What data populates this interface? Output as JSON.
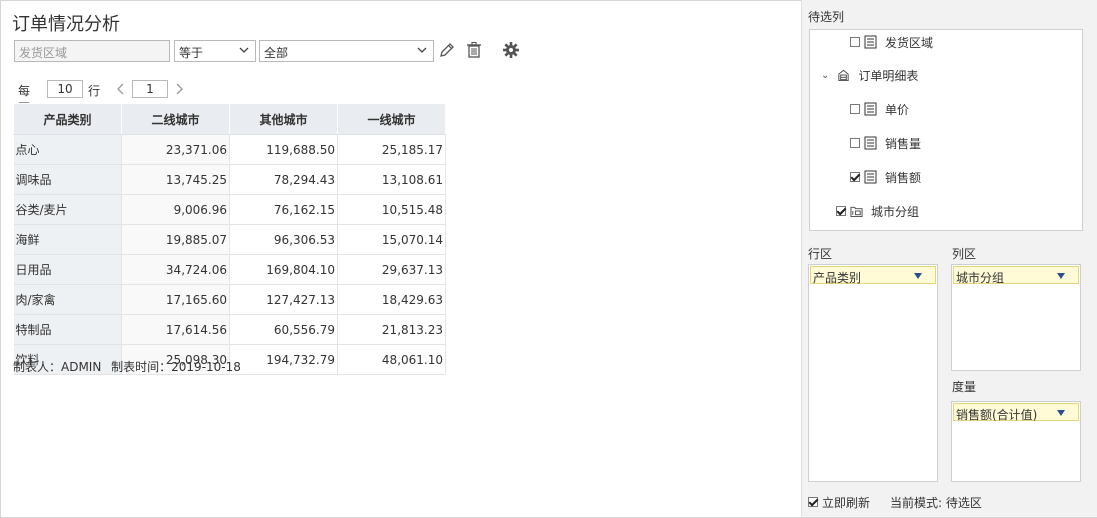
{
  "report": {
    "title": "订单情况分析",
    "filter": {
      "field_placeholder": "发货区域",
      "operator": "等于",
      "value": "全部"
    },
    "pager": {
      "per_page_label": "每页",
      "per_page_value": "10",
      "row_label": "行",
      "page_value": "1"
    },
    "table": {
      "headers": [
        "产品类别",
        "二线城市",
        "其他城市",
        "一线城市"
      ],
      "rows": [
        {
          "cat": "点心",
          "v": [
            "23,371.06",
            "119,688.50",
            "25,185.17"
          ]
        },
        {
          "cat": "调味品",
          "v": [
            "13,745.25",
            "78,294.43",
            "13,108.61"
          ]
        },
        {
          "cat": "谷类/麦片",
          "v": [
            "9,006.96",
            "76,162.15",
            "10,515.48"
          ]
        },
        {
          "cat": "海鲜",
          "v": [
            "19,885.07",
            "96,306.53",
            "15,070.14"
          ]
        },
        {
          "cat": "日用品",
          "v": [
            "34,724.06",
            "169,804.10",
            "29,637.13"
          ]
        },
        {
          "cat": "肉/家禽",
          "v": [
            "17,165.60",
            "127,427.13",
            "18,429.63"
          ]
        },
        {
          "cat": "特制品",
          "v": [
            "17,614.56",
            "60,556.79",
            "21,813.23"
          ]
        },
        {
          "cat": "饮料",
          "v": [
            "25,098.30",
            "194,732.79",
            "48,061.10"
          ]
        }
      ]
    },
    "footer": {
      "maker": "制表人：ADMIN",
      "time": "制表时间：2019-10-18"
    }
  },
  "panel": {
    "pending_title": "待选列",
    "tree": {
      "shipping_region": "发货区域",
      "order_detail_table": "订单明细表",
      "unit_price": "单价",
      "sales_qty": "销售量",
      "sales_amount": "销售额",
      "city_group": "城市分组"
    },
    "row_zone_title": "行区",
    "col_zone_title": "列区",
    "measure_title": "度量",
    "row_chip": "产品类别",
    "col_chip": "城市分组",
    "measure_chip": "销售额(合计值)",
    "instant_refresh": "立即刷新",
    "mode_text": "当前模式: 待选区"
  }
}
